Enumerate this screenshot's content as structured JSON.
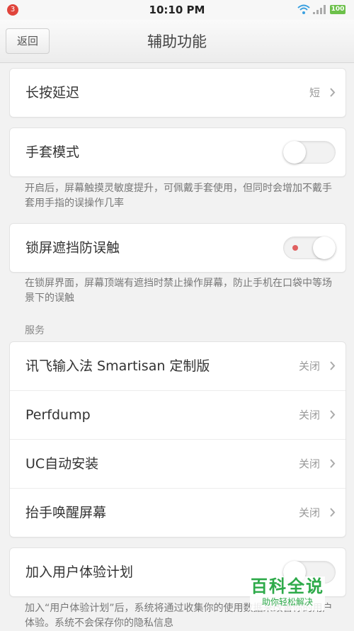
{
  "status_bar": {
    "notification_count": "3",
    "time": "10:10 PM",
    "battery": "100"
  },
  "nav": {
    "back_label": "返回",
    "title": "辅助功能"
  },
  "settings": {
    "long_press_delay": {
      "label": "长按延迟",
      "value": "短"
    },
    "glove_mode": {
      "label": "手套模式",
      "enabled": false,
      "description": "开启后，屏幕触摸灵敏度提升，可佩戴手套使用，但同时会增加不戴手套用手指的误操作几率"
    },
    "screen_lock_touch": {
      "label": "锁屏遮挡防误触",
      "enabled": true,
      "description": "在锁屏界面，屏幕顶端有遮挡时禁止操作屏幕，防止手机在口袋中等场景下的误触"
    }
  },
  "services": {
    "header": "服务",
    "items": [
      {
        "label": "讯飞输入法 Smartisan 定制版",
        "value": "关闭"
      },
      {
        "label": "Perfdump",
        "value": "关闭"
      },
      {
        "label": "UC自动安装",
        "value": "关闭"
      },
      {
        "label": "抬手唤醒屏幕",
        "value": "关闭"
      }
    ]
  },
  "user_experience": {
    "label": "加入用户体验计划",
    "enabled": false,
    "description": "加入“用户体验计划”后，系统将通过收集你的使用数据来改善你的用户体验。系统不会保存你的隐私信息"
  },
  "watermark": {
    "title": "百科全说",
    "subtitle": "助你轻松解决"
  },
  "colors": {
    "background": "#f2f2f2",
    "accent_green": "#2eaa4a",
    "badge_red": "#e0443b",
    "toggle_dot": "#e06060"
  }
}
